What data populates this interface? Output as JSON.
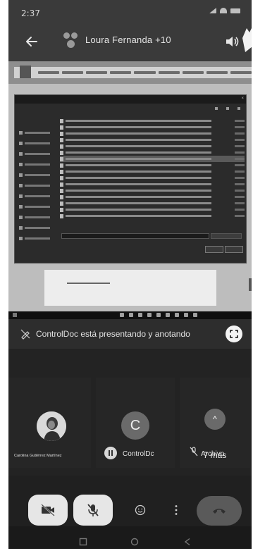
{
  "status_bar": {
    "time": "2:37",
    "icons": [
      "alarm-icon",
      "signal-icon",
      "wifi-icon",
      "battery-icon"
    ]
  },
  "header": {
    "title": "Loura Fernanda +10",
    "icons": [
      "back-arrow-icon",
      "group-avatar-icon",
      "speaker-icon"
    ]
  },
  "shared_screen": {
    "dialog": {
      "sidebar": [
        "",
        "",
        "",
        "",
        "",
        "",
        "",
        "",
        "",
        "",
        ""
      ],
      "files": [
        {
          "name": "",
          "size": "",
          "selected": false
        },
        {
          "name": "",
          "size": "",
          "selected": false
        },
        {
          "name": "",
          "size": "",
          "selected": false
        },
        {
          "name": "",
          "size": "",
          "selected": false
        },
        {
          "name": "",
          "size": "",
          "selected": false
        },
        {
          "name": "",
          "size": "",
          "selected": false
        },
        {
          "name": "",
          "size": "",
          "selected": true
        },
        {
          "name": "",
          "size": "",
          "selected": false
        },
        {
          "name": "",
          "size": "",
          "selected": false
        },
        {
          "name": "",
          "size": "",
          "selected": false
        },
        {
          "name": "",
          "size": "",
          "selected": false
        },
        {
          "name": "",
          "size": "",
          "selected": false
        },
        {
          "name": "",
          "size": "",
          "selected": false
        },
        {
          "name": "",
          "size": "",
          "selected": false
        },
        {
          "name": "",
          "size": "",
          "selected": false
        },
        {
          "name": "",
          "size": "",
          "selected": false
        }
      ]
    },
    "taskbar": {
      "app_icons": 9
    }
  },
  "presenting_banner": {
    "text": "ControlDoc está presentando y anotando"
  },
  "participants": [
    {
      "name": "Carolina Gutiérrez Martínez",
      "avatar": "photo"
    },
    {
      "name": "ControlDc",
      "avatar": "C"
    },
    {
      "name": "Archivo",
      "avatar": "^",
      "more_label": "7 más"
    }
  ],
  "controls": {
    "icons": [
      "camera-off-icon",
      "mic-off-icon",
      "emoji-icon",
      "more-vert-icon",
      "hangup-icon"
    ]
  },
  "navigation": {
    "icons": [
      "recents-icon",
      "home-icon",
      "back-icon"
    ]
  },
  "colors": {
    "bar_bg": "#3a3a3a",
    "tile_bg": "#262626",
    "button_light": "#e6e6e6",
    "hangup": "#5a5a5a"
  }
}
